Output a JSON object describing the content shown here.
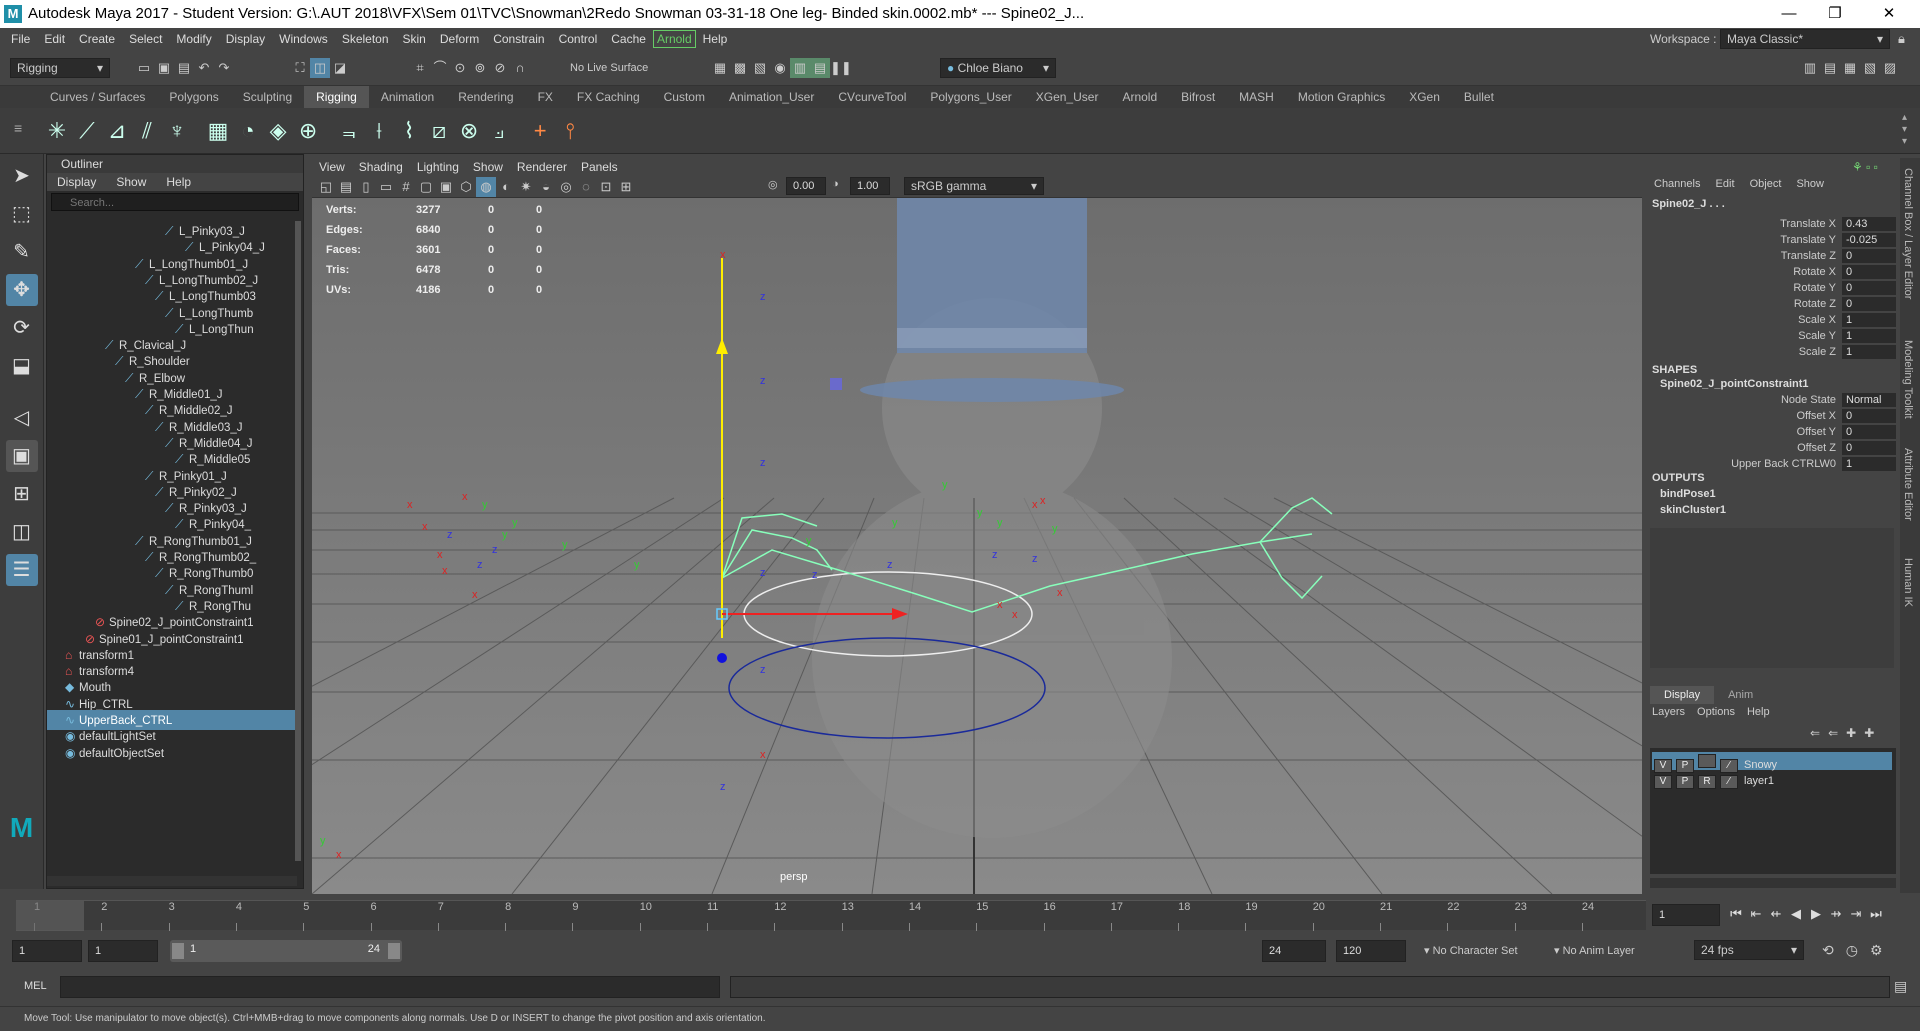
{
  "window": {
    "title": "Autodesk Maya 2017 - Student Version: G:\\.AUT 2018\\VFX\\Sem 01\\TVC\\Snowman\\2Redo Snowman 03-31-18 One leg- Binded skin.0002.mb*   ---   Spine02_J...",
    "logo": "M",
    "minimize": "—",
    "maximize": "❐",
    "close": "✕"
  },
  "menubar": {
    "items": [
      "File",
      "Edit",
      "Create",
      "Select",
      "Modify",
      "Display",
      "Windows",
      "Skeleton",
      "Skin",
      "Deform",
      "Constrain",
      "Control",
      "Cache"
    ],
    "arnold": "Arnold",
    "help": "Help",
    "workspace_label": "Workspace :",
    "workspace_value": "Maya Classic*"
  },
  "statusline": {
    "menuset": "Rigging",
    "live_surface": "No Live Surface",
    "user": "Chloe Biano"
  },
  "shelf_tabs": [
    "Curves / Surfaces",
    "Polygons",
    "Sculpting",
    "Rigging",
    "Animation",
    "Rendering",
    "FX",
    "FX Caching",
    "Custom",
    "Animation_User",
    "CVcurveTool",
    "Polygons_User",
    "XGen_User",
    "Arnold",
    "Bifrost",
    "MASH",
    "Motion Graphics",
    "XGen",
    "Bullet"
  ],
  "outliner": {
    "title": "Outliner",
    "menu": [
      "Display",
      "Show",
      "Help"
    ],
    "search_placeholder": "Search...",
    "rows": [
      {
        "label": "L_Pinky03_J"
      },
      {
        "label": "L_Pinky04_J"
      },
      {
        "label": "L_LongThumb01_J"
      },
      {
        "label": "L_LongThumb02_J"
      },
      {
        "label": "L_LongThumb03"
      },
      {
        "label": "L_LongThumb"
      },
      {
        "label": "L_LongThun"
      },
      {
        "label": "R_Clavical_J"
      },
      {
        "label": "R_Shoulder"
      },
      {
        "label": "R_Elbow"
      },
      {
        "label": "R_Middle01_J"
      },
      {
        "label": "R_Middle02_J"
      },
      {
        "label": "R_Middle03_J"
      },
      {
        "label": "R_Middle04_J"
      },
      {
        "label": "R_Middle05"
      },
      {
        "label": "R_Pinky01_J"
      },
      {
        "label": "R_Pinky02_J"
      },
      {
        "label": "R_Pinky03_J"
      },
      {
        "label": "R_Pinky04_"
      },
      {
        "label": "R_RongThumb01_J"
      },
      {
        "label": "R_RongThumb02_"
      },
      {
        "label": "R_RongThumb0"
      },
      {
        "label": "R_RongThuml"
      },
      {
        "label": "R_RongThu"
      },
      {
        "label": "Spine02_J_pointConstraint1"
      },
      {
        "label": "Spine01_J_pointConstraint1"
      },
      {
        "label": "transform1"
      },
      {
        "label": "transform4"
      },
      {
        "label": "Mouth"
      },
      {
        "label": "Hip_CTRL"
      },
      {
        "label": "UpperBack_CTRL"
      },
      {
        "label": "defaultLightSet"
      },
      {
        "label": "defaultObjectSet"
      }
    ]
  },
  "viewport": {
    "menu": [
      "View",
      "Shading",
      "Lighting",
      "Show",
      "Renderer",
      "Panels"
    ],
    "exposure": "0.00",
    "gamma": "1.00",
    "colorspace": "sRGB gamma",
    "camera_label": "persp",
    "hud": [
      {
        "label": "Verts:",
        "v1": "3277",
        "v2": "0",
        "v3": "0"
      },
      {
        "label": "Edges:",
        "v1": "6840",
        "v2": "0",
        "v3": "0"
      },
      {
        "label": "Faces:",
        "v1": "3601",
        "v2": "0",
        "v3": "0"
      },
      {
        "label": "Tris:",
        "v1": "6478",
        "v2": "0",
        "v3": "0"
      },
      {
        "label": "UVs:",
        "v1": "4186",
        "v2": "0",
        "v3": "0"
      }
    ]
  },
  "channelbox": {
    "menu": [
      "Channels",
      "Edit",
      "Object",
      "Show"
    ],
    "object_name": "Spine02_J . . .",
    "channels": [
      {
        "label": "Translate X",
        "value": "0.43"
      },
      {
        "label": "Translate Y",
        "value": "-0.025"
      },
      {
        "label": "Translate Z",
        "value": "0"
      },
      {
        "label": "Rotate X",
        "value": "0"
      },
      {
        "label": "Rotate Y",
        "value": "0"
      },
      {
        "label": "Rotate Z",
        "value": "0"
      },
      {
        "label": "Scale X",
        "value": "1"
      },
      {
        "label": "Scale Y",
        "value": "1"
      },
      {
        "label": "Scale Z",
        "value": "1"
      }
    ],
    "shapes_header": "SHAPES",
    "shape_name": "Spine02_J_pointConstraint1",
    "shape_channels": [
      {
        "label": "Node State",
        "value": "Normal"
      },
      {
        "label": "Offset X",
        "value": "0"
      },
      {
        "label": "Offset Y",
        "value": "0"
      },
      {
        "label": "Offset Z",
        "value": "0"
      },
      {
        "label": "Upper Back CTRLW0",
        "value": "1"
      }
    ],
    "outputs_header": "OUTPUTS",
    "outputs": [
      "bindPose1",
      "skinCluster1"
    ]
  },
  "layers": {
    "tabs": [
      "Display",
      "Anim"
    ],
    "menu": [
      "Layers",
      "Options",
      "Help"
    ],
    "rows": [
      {
        "v": "V",
        "p": "P",
        "r": "",
        "name": "Snowy"
      },
      {
        "v": "V",
        "p": "P",
        "r": "R",
        "name": "layer1"
      }
    ]
  },
  "side_tabs": [
    "Channel Box / Layer Editor",
    "Modeling Toolkit",
    "Attribute Editor",
    "Human IK"
  ],
  "timeline": {
    "ticks": [
      "1",
      "2",
      "3",
      "4",
      "5",
      "6",
      "7",
      "8",
      "9",
      "10",
      "11",
      "12",
      "13",
      "14",
      "15",
      "16",
      "17",
      "18",
      "19",
      "20",
      "21",
      "22",
      "23",
      "24"
    ],
    "current_frame": "1",
    "range_start": "1",
    "range_inner_start": "1",
    "slider_start": "1",
    "slider_end": "24",
    "range_end": "24",
    "anim_end": "120",
    "character_set": "No Character Set",
    "anim_layer": "No Anim Layer",
    "fps": "24 fps"
  },
  "cmdline": {
    "label": "MEL"
  },
  "helpline": {
    "text": "Move Tool: Use manipulator to move object(s). Ctrl+MMB+drag to move components along normals. Use D or INSERT to change the pivot position and axis orientation."
  }
}
